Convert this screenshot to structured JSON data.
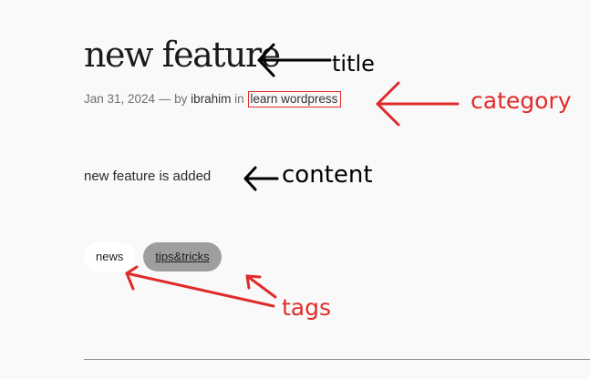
{
  "post": {
    "title": "new feature",
    "meta": {
      "date": "Jan 31, 2024",
      "dash": " — by ",
      "author": "ibrahim",
      "in_word": " in ",
      "category": "learn wordpress"
    },
    "content": "new feature is added",
    "tags": [
      "news",
      "tips&tricks"
    ]
  },
  "annotations": {
    "title_label": "title",
    "category_label": "category",
    "content_label": "content",
    "tags_label": "tags"
  },
  "colors": {
    "annotation_black": "#000000",
    "annotation_red": "#e02b2b",
    "category_border": "#e02b2b",
    "tag_hover_bg": "#9e9e9e",
    "page_bg": "#f9f9f9"
  }
}
